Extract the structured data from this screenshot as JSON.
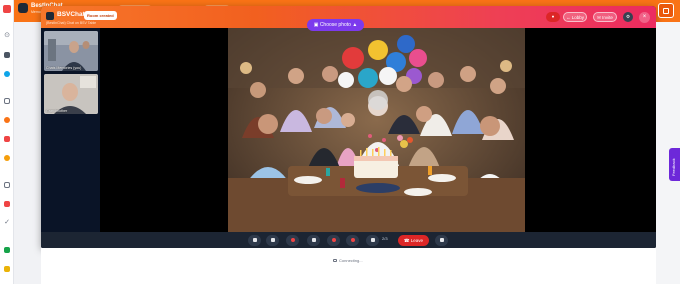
{
  "app_header": {
    "title": "BestInChat",
    "subtitle": "Memorable moments"
  },
  "modal": {
    "title": "BSVChat",
    "status_badge": "Room created",
    "subtitle": "(BestInChat) Chat on BSV Table",
    "choose_photo": "Choose photo",
    "lobby": "Lobby",
    "invite": "Invite",
    "close": "×"
  },
  "participants": [
    {
      "label": "Chats Memories (you)"
    },
    {
      "label": "Grandmother"
    }
  ],
  "controls": {
    "page": "2/3",
    "leave": "Leave"
  },
  "status": {
    "connecting": "Connecting..."
  },
  "side": {
    "feedback": "Feedback"
  },
  "colors": {
    "header_orange": "#f97316",
    "accent_purple": "#7c3aed",
    "leave_red": "#dc2626",
    "stage_dark": "#0b1220"
  },
  "icons": {
    "rail": [
      "pin-icon",
      "chat-icon",
      "globe-icon",
      "message-icon",
      "phone-icon",
      "share-icon",
      "coin-icon",
      "calendar-icon",
      "megaphone-icon",
      "check-icon",
      "user-add-icon",
      "wallet-icon"
    ]
  }
}
